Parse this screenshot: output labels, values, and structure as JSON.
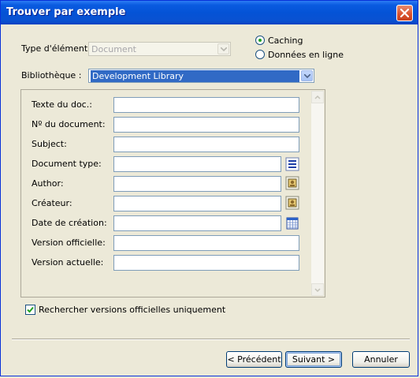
{
  "window": {
    "title": "Trouver par exemple"
  },
  "item_type": {
    "label": "Type d'élément :",
    "value": "Document",
    "disabled": true
  },
  "mode": {
    "options": [
      {
        "label": "Caching",
        "selected": true
      },
      {
        "label": "Données en ligne",
        "selected": false
      }
    ]
  },
  "library": {
    "label": "Bibliothèque :",
    "value": "Development Library"
  },
  "fields": [
    {
      "label": "Texte du doc.:",
      "value": ""
    },
    {
      "label": "Nº du document:",
      "value": ""
    },
    {
      "label": "Subject:",
      "value": ""
    },
    {
      "label": "Document type:",
      "value": "",
      "button_icon": "list-icon"
    },
    {
      "label": "Author:",
      "value": "",
      "button_icon": "user-picker-icon"
    },
    {
      "label": "Créateur:",
      "value": "",
      "button_icon": "user-picker-icon"
    },
    {
      "label": "Date de création:",
      "value": "",
      "button_icon": "calendar-icon"
    },
    {
      "label": "Version officielle:",
      "value": ""
    },
    {
      "label": "Version actuelle:",
      "value": ""
    }
  ],
  "official_only": {
    "label": "Rechercher versions officielles uniquement",
    "checked": true
  },
  "buttons": {
    "previous": "< Précédent",
    "next": "Suivant >",
    "cancel": "Annuler"
  },
  "colors": {
    "titlebar": "#0453D6",
    "window_bg": "#ECE9D8",
    "selection": "#316AC5",
    "close": "#D9502C"
  }
}
